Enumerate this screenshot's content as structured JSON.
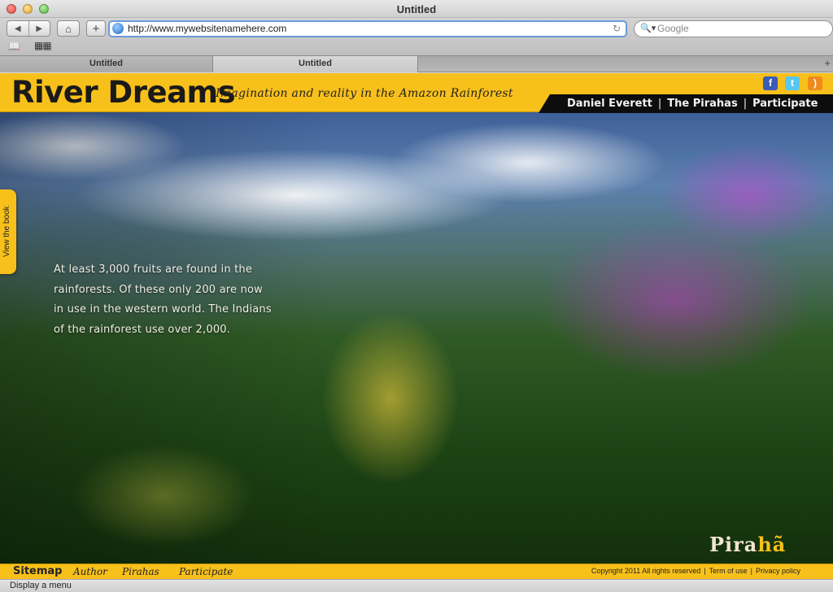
{
  "window": {
    "title": "Untitled"
  },
  "toolbar": {
    "back_icon": "back-arrow-icon",
    "forward_icon": "forward-arrow-icon",
    "home_icon": "home-icon",
    "add_icon": "plus-icon",
    "url": "http://www.mywebsitenamehere.com",
    "search_placeholder": "Google"
  },
  "tabs": [
    {
      "label": "Untitled"
    },
    {
      "label": "Untitled"
    }
  ],
  "site": {
    "title": "River Dreams",
    "tagline": "Imagination and reality in the Amazon Rainforest",
    "social": [
      "facebook-icon",
      "twitter-icon",
      "rss-icon"
    ],
    "nav": [
      "Daniel Everett",
      "The Pirahas",
      "Participate"
    ],
    "nav_separator": "|",
    "side_tab": "View the book",
    "fact": "At least 3,000 fruits are found in the rainforests. Of these only 200 are now in use in the western world. The Indians of the rainforest use over 2,000.",
    "logo_main": "Pira",
    "logo_accent": "hã",
    "colors": {
      "brand_yellow": "#f8c01a",
      "nav_black": "#0d0d0d"
    }
  },
  "footer": {
    "sitemap": "Sitemap",
    "links": [
      "Author",
      "Pirahas",
      "Participate"
    ],
    "copyright": "Copyright 2011 All rights reserved",
    "terms": "Term of use",
    "privacy": "Privacy policy"
  },
  "statusbar": {
    "text": "Display a menu"
  }
}
